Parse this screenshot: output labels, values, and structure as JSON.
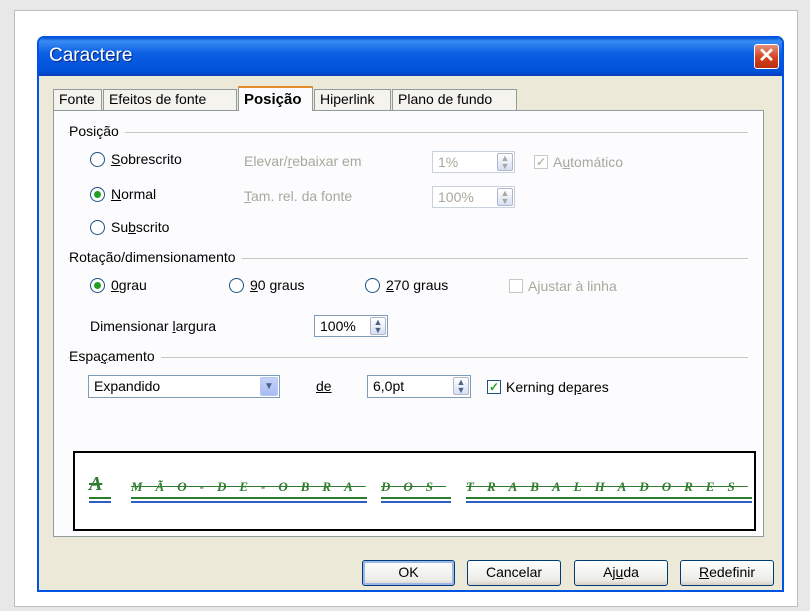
{
  "dialog": {
    "title": "Caractere",
    "close_icon": "close-icon",
    "close_glyph": "✕"
  },
  "tabs": [
    {
      "label": "Fonte"
    },
    {
      "label": "Efeitos de fonte"
    },
    {
      "label": "Posição",
      "active": true
    },
    {
      "label": "Hiperlink"
    },
    {
      "label": "Plano de fundo"
    }
  ],
  "posicao": {
    "section_label": "Posição",
    "options": [
      {
        "label_pre": "",
        "label_u": "S",
        "label_post": "obrescrito",
        "selected": false
      },
      {
        "label_pre": "",
        "label_u": "N",
        "label_post": "ormal",
        "selected": true
      },
      {
        "label_pre": "Su",
        "label_u": "b",
        "label_post": "scrito",
        "selected": false
      }
    ],
    "raise_label_pre": "Elevar/",
    "raise_label_u": "r",
    "raise_label_post": "ebaixar em",
    "raise_value": "1%",
    "auto_label_pre": "A",
    "auto_label_u": "u",
    "auto_label_post": "tomático",
    "auto_checked": true,
    "size_label_pre": "",
    "size_label_u": "T",
    "size_label_post": "am. rel. da fonte",
    "size_value": "100%"
  },
  "rotacao": {
    "section_label": "Rotação/dimensionamento",
    "options": [
      {
        "label_pre": "",
        "label_u": "0",
        "label_post": " grau",
        "selected": true
      },
      {
        "label_pre": "",
        "label_u": "9",
        "label_post": "0 graus",
        "selected": false
      },
      {
        "label_pre": "",
        "label_u": "2",
        "label_post": "70 graus",
        "selected": false
      }
    ],
    "fit_line_pre": "A",
    "fit_line_u": "j",
    "fit_line_post": "ustar à linha",
    "fit_line_checked": false,
    "scale_width_pre": "Dimensionar ",
    "scale_width_u": "l",
    "scale_width_post": "argura",
    "scale_width_value": "100%"
  },
  "espacamento": {
    "section_label_pre": "Espa",
    "section_label_u": "ç",
    "section_label_post": "amento",
    "mode_value": "Expandido",
    "de_label": "de",
    "amount_value": "6,0pt",
    "kerning_pre": "Kerning de ",
    "kerning_u": "p",
    "kerning_post": "ares",
    "kerning_checked": true
  },
  "preview": {
    "text": "A MÃO-DE-OBRA DOS TRABALHADORES",
    "words": [
      "A",
      "MÃO-DE-OBRA",
      "DOS",
      "TRABALHADORES"
    ],
    "text_color": "#2f7c2f",
    "underline_color": "#2a5fc8"
  },
  "buttons": {
    "ok": "OK",
    "cancel": "Cancelar",
    "help_pre": "Aj",
    "help_u": "u",
    "help_post": "da",
    "reset_pre": "",
    "reset_u": "R",
    "reset_post": "edefinir"
  },
  "colors": {
    "titlebar": "#0b5fe3",
    "dialog_bg": "#ece9d8",
    "check_green": "#21a121",
    "tab_active_accent": "#e68b2c"
  }
}
